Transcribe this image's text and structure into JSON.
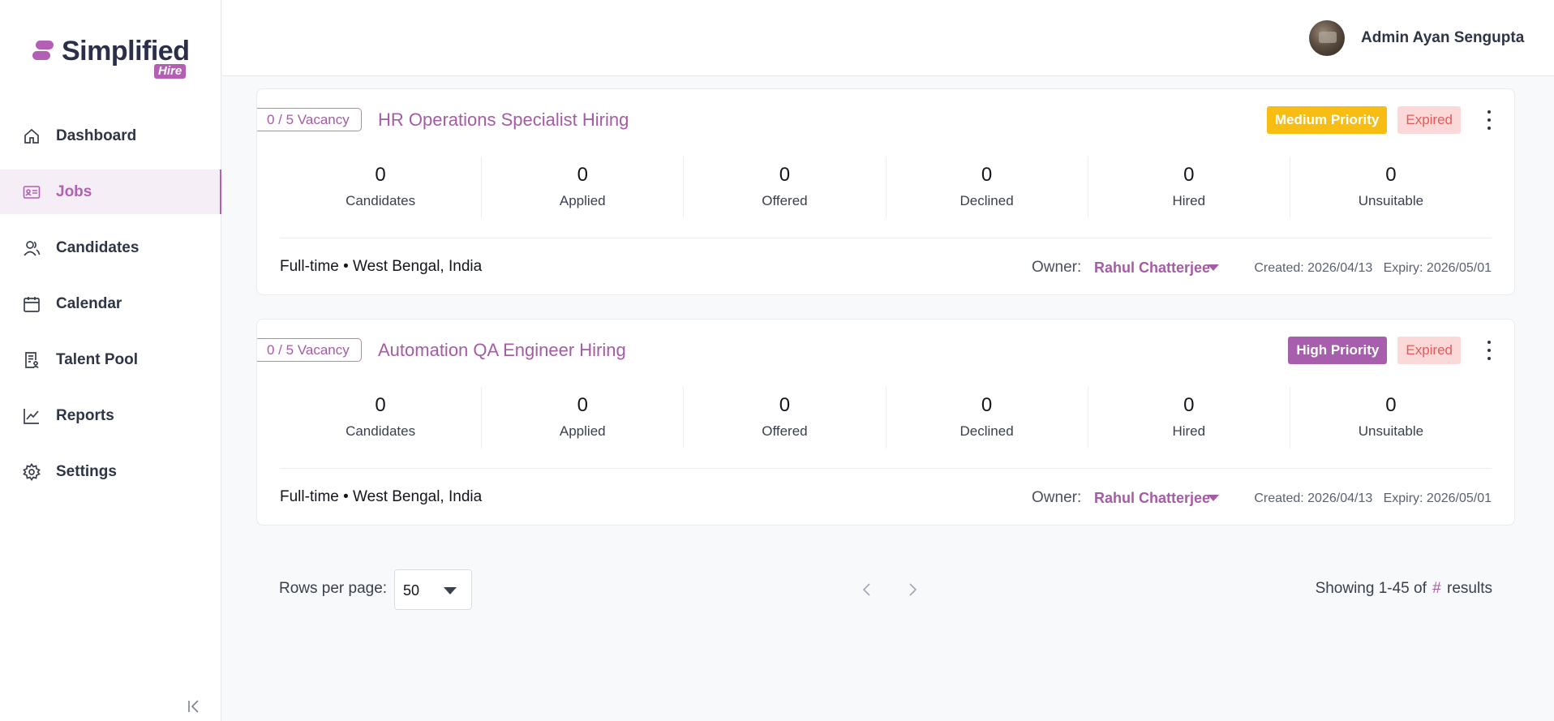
{
  "brand": {
    "name": "Simplified",
    "tag": "Hire"
  },
  "user": {
    "name": "Admin Ayan Sengupta"
  },
  "sidebar": {
    "items": [
      {
        "label": "Dashboard",
        "icon": "home-icon"
      },
      {
        "label": "Jobs",
        "icon": "id-card-icon",
        "active": true
      },
      {
        "label": "Candidates",
        "icon": "users-icon"
      },
      {
        "label": "Calendar",
        "icon": "calendar-icon"
      },
      {
        "label": "Talent Pool",
        "icon": "talent-pool-icon"
      },
      {
        "label": "Reports",
        "icon": "chart-line-icon"
      },
      {
        "label": "Settings",
        "icon": "gear-icon"
      }
    ]
  },
  "jobs": [
    {
      "vacancy": "0 / 5 Vacancy",
      "title": "HR Operations Specialist Hiring",
      "priority": "Medium Priority",
      "status": "Expired",
      "stats": [
        {
          "value": "0",
          "label": "Candidates"
        },
        {
          "value": "0",
          "label": "Applied"
        },
        {
          "value": "0",
          "label": "Offered"
        },
        {
          "value": "0",
          "label": "Declined"
        },
        {
          "value": "0",
          "label": "Hired"
        },
        {
          "value": "0",
          "label": "Unsuitable"
        }
      ],
      "meta": "Full-time • West Bengal, India",
      "owner_label": "Owner:",
      "owner": "Rahul Chatterjee",
      "created": "Created: 2026/04/13",
      "expiry": "Expiry: 2026/05/01"
    },
    {
      "vacancy": "0 / 5 Vacancy",
      "title": "Automation QA Engineer Hiring",
      "priority": "High Priority",
      "status": "Expired",
      "stats": [
        {
          "value": "0",
          "label": "Candidates"
        },
        {
          "value": "0",
          "label": "Applied"
        },
        {
          "value": "0",
          "label": "Offered"
        },
        {
          "value": "0",
          "label": "Declined"
        },
        {
          "value": "0",
          "label": "Hired"
        },
        {
          "value": "0",
          "label": "Unsuitable"
        }
      ],
      "meta": "Full-time • West Bengal, India",
      "owner_label": "Owner:",
      "owner": "Rahul Chatterjee",
      "created": "Created: 2026/04/13",
      "expiry": "Expiry: 2026/05/01"
    }
  ],
  "pagination": {
    "rows_label": "Rows per page:",
    "rows_value": "50",
    "showing_prefix": "Showing 1-45 of",
    "showing_hash": "#",
    "showing_suffix": "results"
  },
  "colors": {
    "accent": "#a45ca5",
    "medium_priority": "#f8bd12",
    "high_priority": "#a75fad",
    "expired_bg": "#fbd9d9",
    "expired_text": "#e45a5a"
  }
}
